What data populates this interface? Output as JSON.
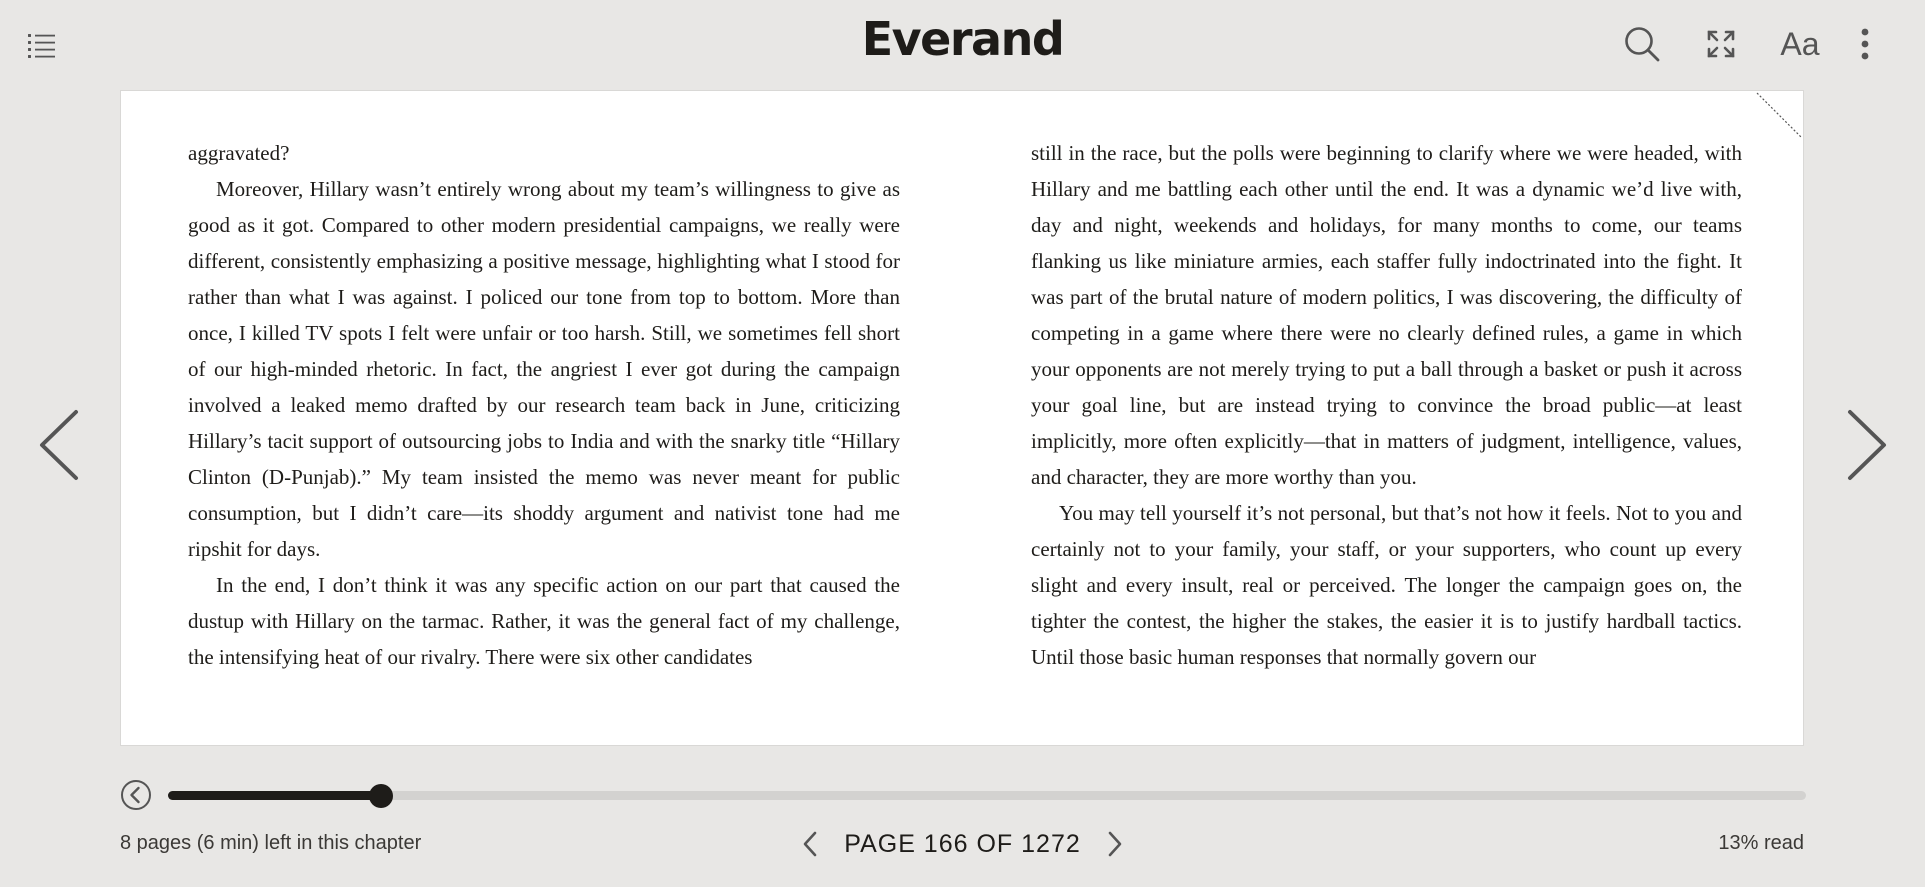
{
  "header": {
    "logo": "Everand",
    "font_settings_label": "Aa"
  },
  "icons": {
    "toc": "list-icon",
    "search": "search-icon",
    "fullscreen": "expand-icon",
    "more": "more-vertical-icon",
    "prev_page": "chevron-left-icon",
    "next_page": "chevron-right-icon",
    "back": "circle-back-icon"
  },
  "book": {
    "left_column": [
      {
        "indent": false,
        "text": "aggravated?"
      },
      {
        "indent": true,
        "text": "Moreover, Hillary wasn’t entirely wrong about my team’s willingness to give as good as it got. Compared to other modern presidential campaigns, we really were different, consistently emphasizing a positive message, highlighting what I stood for rather than what I was against. I policed our tone from top to bot­tom. More than once, I killed TV spots I felt were unfair or too harsh. Still, we sometimes fell short of our high-minded rhetoric. In fact, the angriest I ever got during the campaign involved a leaked memo drafted by our research team back in June, criticizing Hillary’s tacit support of outsourcing jobs to India and with the snarky title “Hillary Clinton (D-Punjab).” My team insisted the memo was never meant for public consumption, but I didn’t care—its shoddy argu­ment and nativist tone had me ripshit for days."
      },
      {
        "indent": true,
        "text": "In the end, I don’t think it was any specific action on our part that caused the dustup with Hillary on the tarmac. Rather, it was the general fact of my challenge, the intensifying heat of our rivalry. There were six other candidates"
      }
    ],
    "right_column": [
      {
        "indent": false,
        "text": "still in the race, but the polls were beginning to clarify where we were headed, with Hillary and me battling each other until the end. It was a dynamic we’d live with, day and night, weekends and holidays, for many months to come, our teams flanking us like miniature armies, each staffer fully indoctrinated into the fight. It was part of the brutal nature of modern politics, I was discovering, the difficulty of competing in a game where there were no clearly defined rules, a game in which your opponents are not merely trying to put a ball through a basket or push it across your goal line, but are instead trying to convince the broad public—at least implicitly, more often explicitly—that in matters of judg­ment, intelligence, values, and character, they are more worthy than you."
      },
      {
        "indent": true,
        "text": "You may tell yourself it’s not personal, but that’s not how it feels. Not to you and certainly not to your family, your staff, or your supporters, who count up every slight and every insult, real or perceived. The longer the campaign goes on, the tighter the contest, the higher the stakes, the easier it is to justify hardball tactics. Until those basic human responses that normally govern our"
      }
    ]
  },
  "progress": {
    "fraction": 0.13
  },
  "footer": {
    "chapter_remaining": "8 pages (6 min) left in this chapter",
    "page_indicator": "PAGE 166 OF 1272",
    "percent_read": "13% read"
  },
  "colors": {
    "background": "#e8e7e5",
    "page": "#ffffff",
    "ink": "#1e1c19",
    "track": "#d3d2d0"
  }
}
